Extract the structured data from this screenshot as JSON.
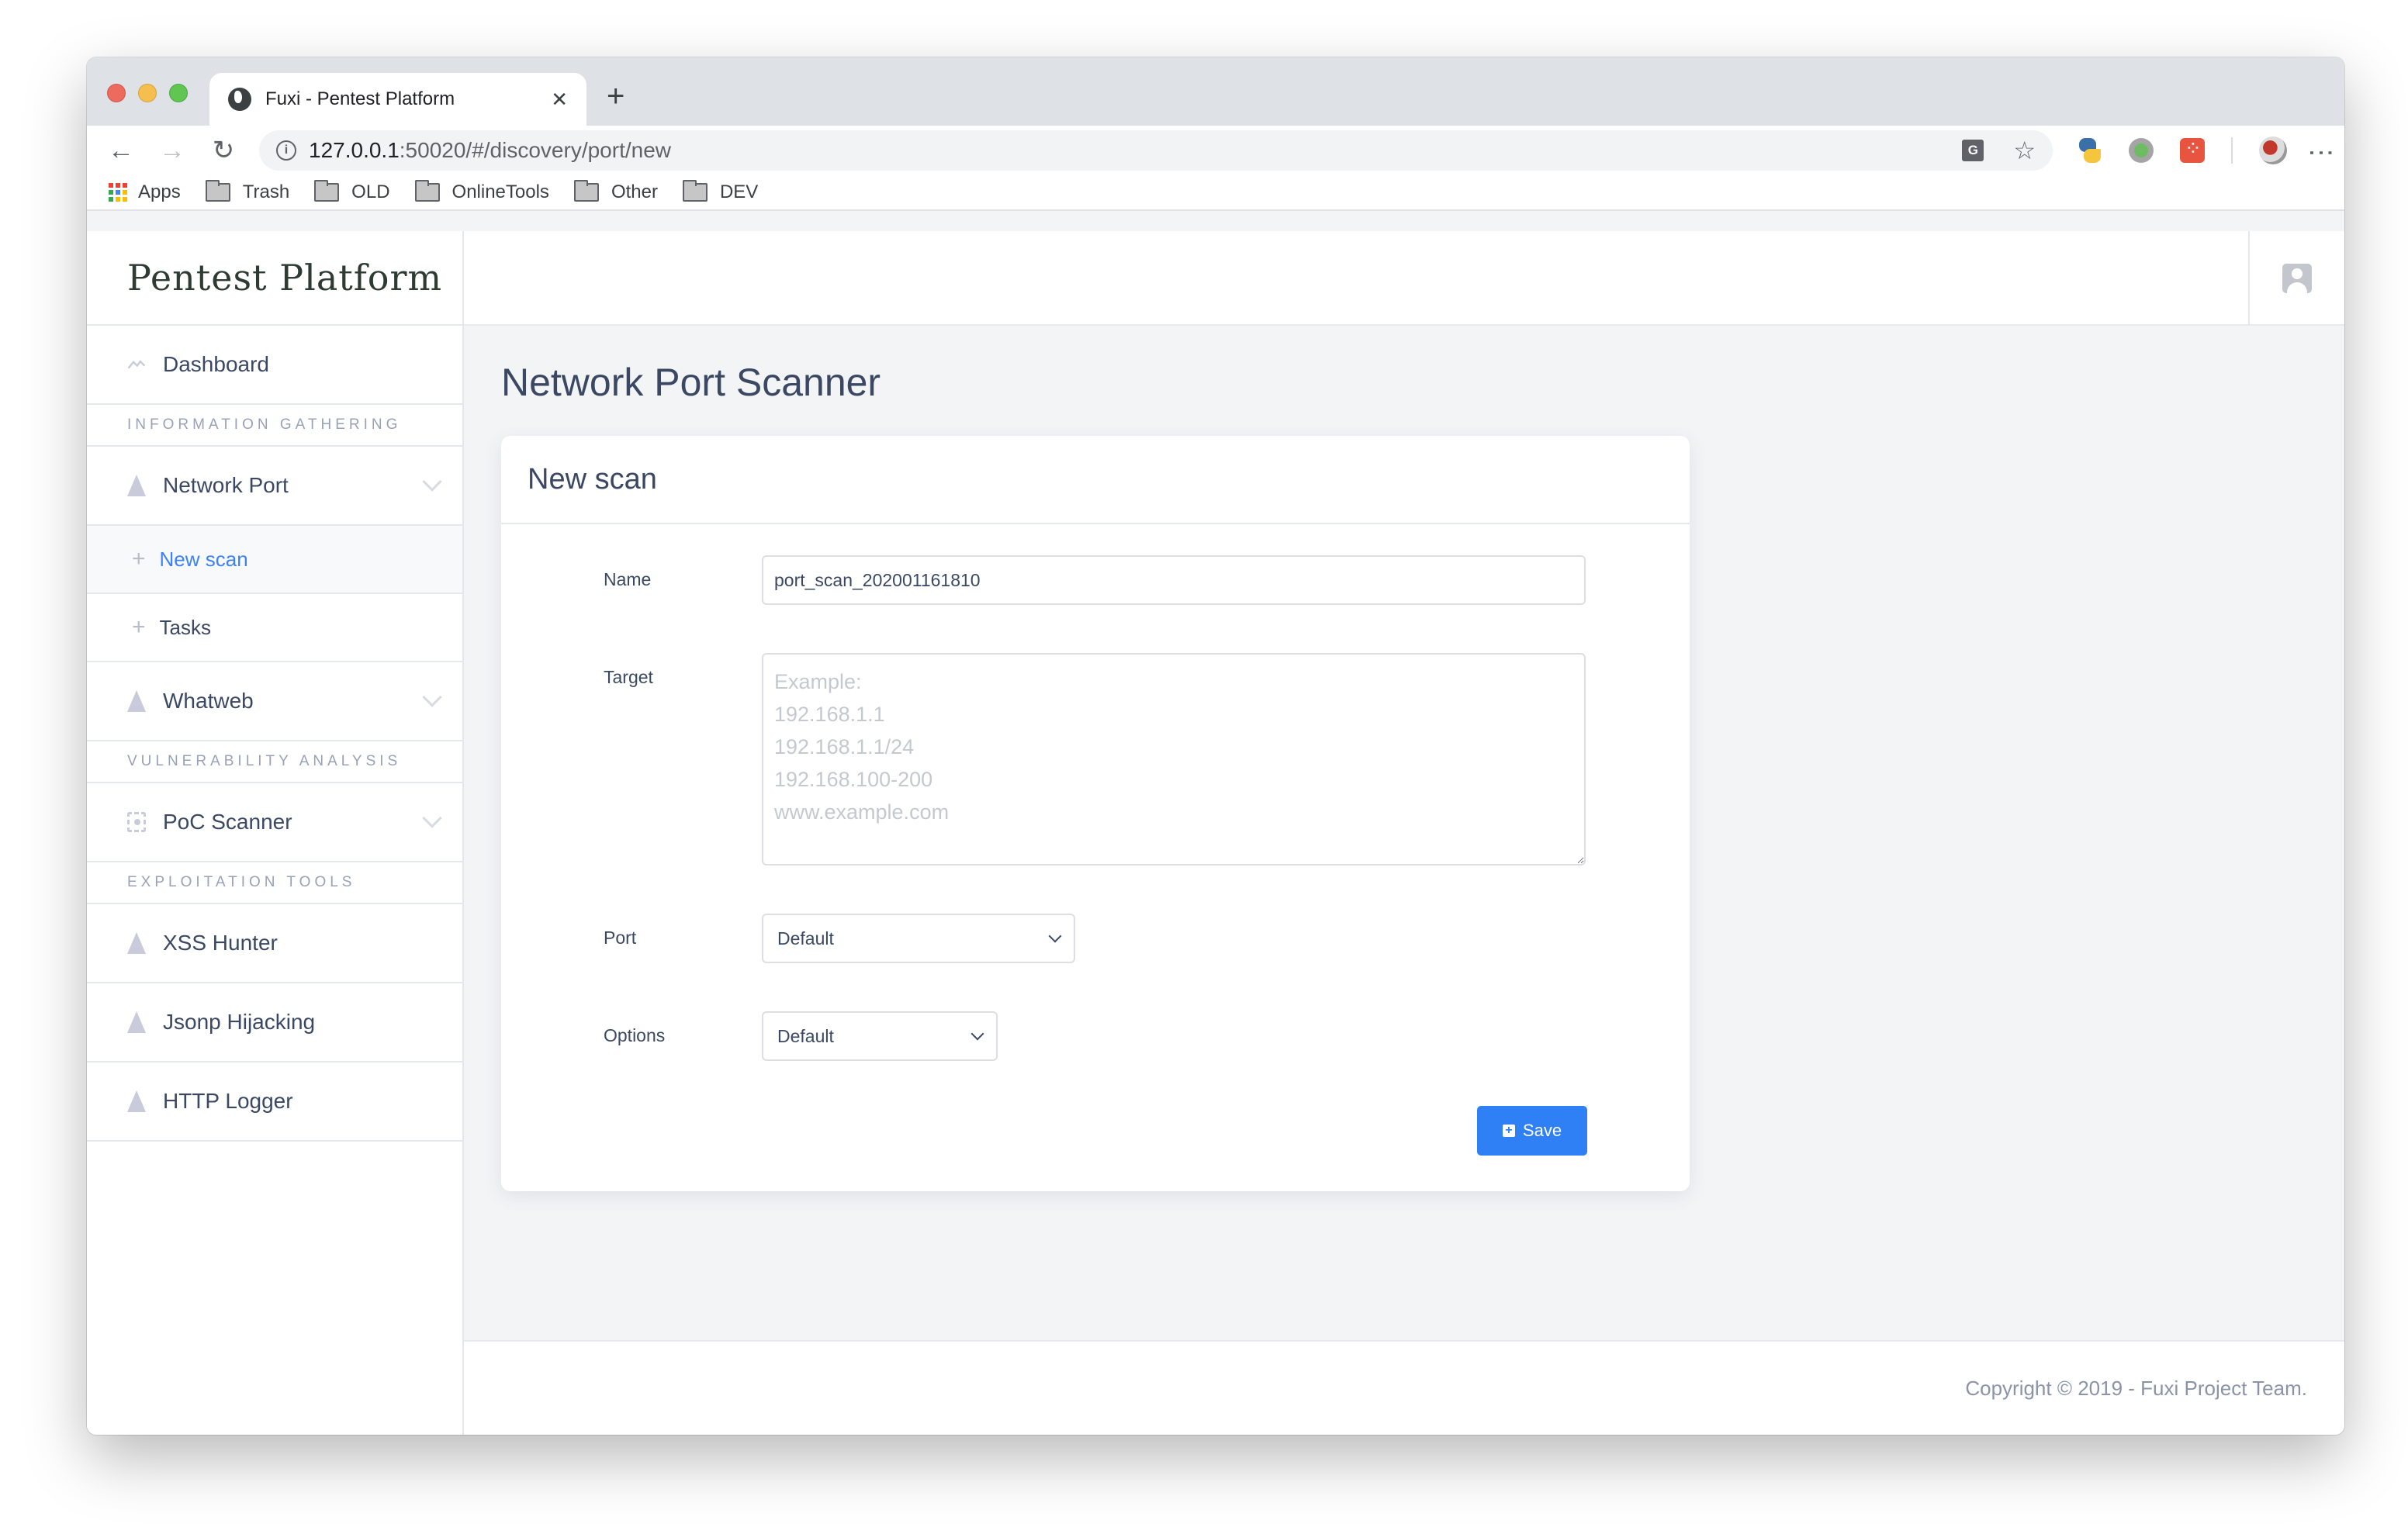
{
  "browser": {
    "tab_title": "Fuxi - Pentest Platform",
    "tab_icon": "globe-icon",
    "new_tab_symbol": "+",
    "close_symbol": "✕",
    "url_host": "127.0.0.1",
    "url_rest": ":50020/#/discovery/port/new",
    "bookmarks": [
      {
        "label": "Apps",
        "icon": "apps-grid-icon"
      },
      {
        "label": "Trash",
        "icon": "folder-icon"
      },
      {
        "label": "OLD",
        "icon": "folder-icon"
      },
      {
        "label": "OnlineTools",
        "icon": "folder-icon"
      },
      {
        "label": "Other",
        "icon": "folder-icon"
      },
      {
        "label": "DEV",
        "icon": "folder-icon"
      }
    ],
    "extensions": [
      "translate-icon",
      "star-icon",
      "python-extension-icon",
      "green-dot-extension-icon",
      "dice-extension-icon",
      "profile-avatar-icon",
      "menu-icon"
    ]
  },
  "sidebar": {
    "brand": "Pentest Platform",
    "dashboard": "Dashboard",
    "sections": [
      {
        "title": "INFORMATION GATHERING"
      },
      {
        "title": "VULNERABILITY ANALYSIS"
      },
      {
        "title": "EXPLOITATION TOOLS"
      }
    ],
    "items": {
      "network_port": "Network Port",
      "new_scan": "New scan",
      "tasks": "Tasks",
      "whatweb": "Whatweb",
      "poc_scanner": "PoC Scanner",
      "xss_hunter": "XSS Hunter",
      "jsonp_hijacking": "Jsonp Hijacking",
      "http_logger": "HTTP Logger"
    },
    "sub_symbol": "+"
  },
  "main": {
    "page_title": "Network Port Scanner",
    "card_title": "New scan",
    "form": {
      "name_label": "Name",
      "name_value": "port_scan_202001161810",
      "target_label": "Target",
      "target_placeholder": "Example:\n192.168.1.1\n192.168.1.1/24\n192.168.100-200\nwww.example.com",
      "port_label": "Port",
      "port_value": "Default",
      "options_label": "Options",
      "options_value": "Default",
      "save_label": "Save",
      "save_symbol": "+"
    }
  },
  "footer": {
    "text": "Copyright © 2019 - Fuxi Project Team."
  },
  "colors": {
    "accent": "#2f80f5",
    "active_link": "#3b82f6",
    "text": "#3b4863"
  }
}
